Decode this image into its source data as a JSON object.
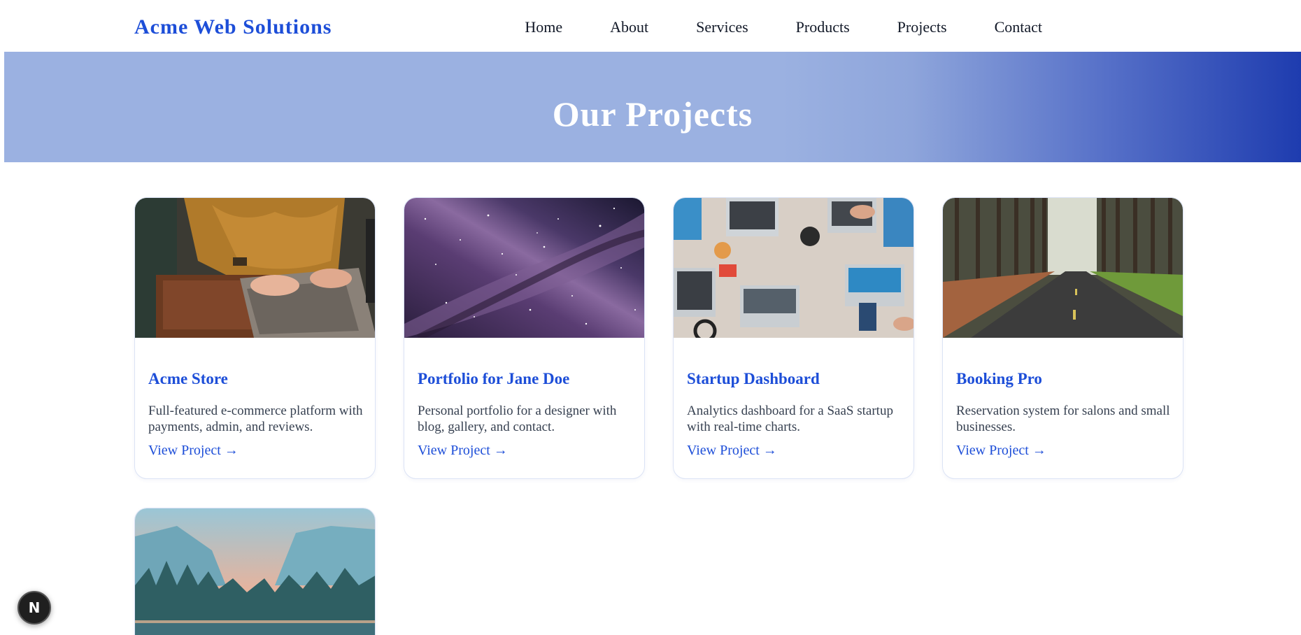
{
  "header": {
    "brand": "Acme Web Solutions",
    "nav": [
      "Home",
      "About",
      "Services",
      "Products",
      "Projects",
      "Contact"
    ]
  },
  "hero": {
    "title": "Our Projects"
  },
  "projects": [
    {
      "title": "Acme Store",
      "description": "Full-featured e-commerce platform with payments, admin, and reviews.",
      "link": "View Project →",
      "image": "laptop-typing-photo"
    },
    {
      "title": "Portfolio for Jane Doe",
      "description": "Personal portfolio for a designer with blog, gallery, and contact.",
      "link": "View Project →",
      "image": "galaxy-photo"
    },
    {
      "title": "Startup Dashboard",
      "description": "Analytics dashboard for a SaaS startup with real-time charts.",
      "link": "View Project →",
      "image": "team-laptops-desk-photo"
    },
    {
      "title": "Booking Pro",
      "description": "Reservation system for salons and small businesses.",
      "link": "View Project →",
      "image": "forest-road-photo"
    },
    {
      "title": "",
      "description": "",
      "link": "",
      "image": "mountain-lake-photo"
    }
  ],
  "badge": {
    "label": "N",
    "icon": "nextjs-logo-icon"
  },
  "colors": {
    "brand": "#1d4ed8",
    "hero_start": "#9bb1e1",
    "hero_end": "#1e3caf"
  }
}
